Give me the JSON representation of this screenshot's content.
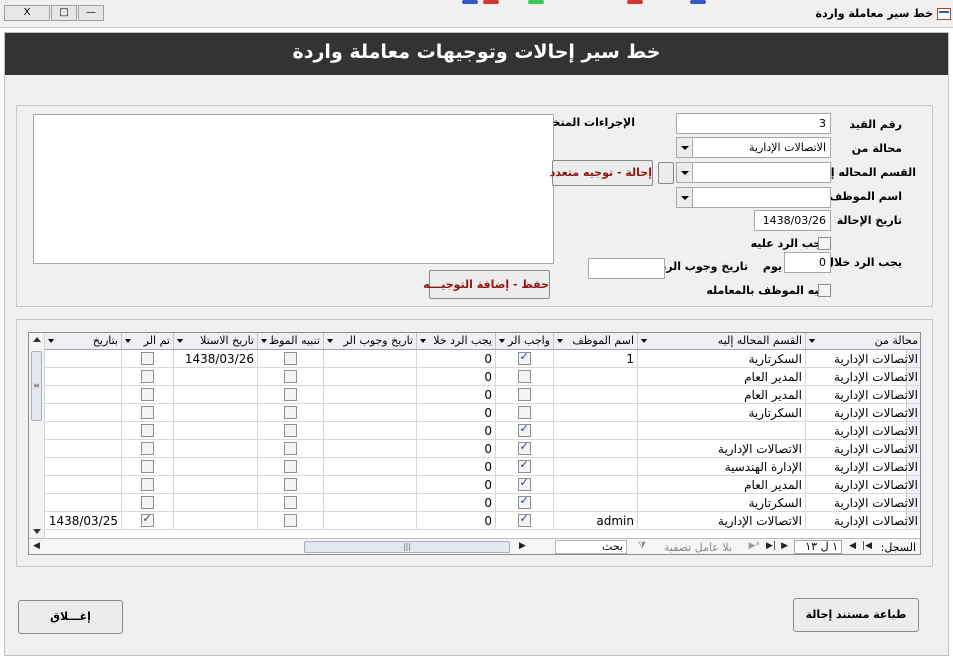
{
  "window": {
    "title": "خط سير معاملة واردة",
    "controls": {
      "close": "X",
      "maximize": "□",
      "minimize": "—"
    }
  },
  "header": {
    "title": "خط سير إحالات وتوجيهات معاملة واردة"
  },
  "form": {
    "record_no_label": "رقم القيد",
    "record_no_value": "3",
    "referred_from_label": "محالة من",
    "referred_from_value": "الاتصالات الإدارية",
    "referred_to_dept_label": "القسم المحاله إليه",
    "referred_to_dept_value": "",
    "employee_name_label": "اسم الموظف",
    "employee_name_value": "",
    "referral_date_label": "تاريخ الإحالة",
    "referral_date_value": "1438/03/26",
    "reply_required_label": "واجب الرد عليه",
    "reply_required_checked": false,
    "reply_within_label": "يجب الرد خلال",
    "reply_within_value": "0",
    "day_label": "يوم",
    "reply_due_date_label": "تاريخ وجوب الرد",
    "reply_due_date_value": "",
    "notify_employee_label": "تنبيه الموظف بالمعامله",
    "notify_employee_checked": false,
    "actions_taken_label": "الإجراءات المتخذه",
    "actions_taken_value": "",
    "multi_referral_button": "إحالة - توجيه متعدد",
    "save_button": "حفظ - إضافة التوجيـــه"
  },
  "grid": {
    "columns": [
      {
        "key": "from",
        "label": "محالة من"
      },
      {
        "key": "dept",
        "label": "القسم المحاله إليه"
      },
      {
        "key": "employee",
        "label": "اسم الموظف"
      },
      {
        "key": "must_reply",
        "label": "واجب الر"
      },
      {
        "key": "reply_within",
        "label": "يجب الرد خلا"
      },
      {
        "key": "due_date",
        "label": "تاريخ وجوب الر"
      },
      {
        "key": "notify",
        "label": "تنبيه الموظ"
      },
      {
        "key": "received_date",
        "label": "تاريخ الاستلا"
      },
      {
        "key": "done",
        "label": "تم الر"
      },
      {
        "key": "on_date",
        "label": "بتاريخ"
      }
    ],
    "rows": [
      {
        "from": "الاتصالات الإدارية",
        "dept": "السكرتارية",
        "employee": "1",
        "must_reply": true,
        "reply_within": "0",
        "due_date": "",
        "notify": false,
        "received_date": "1438/03/26",
        "done": false,
        "on_date": ""
      },
      {
        "from": "الاتصالات الإدارية",
        "dept": "المدير العام",
        "employee": "",
        "must_reply": false,
        "reply_within": "0",
        "due_date": "",
        "notify": false,
        "received_date": "",
        "done": false,
        "on_date": ""
      },
      {
        "from": "الاتصالات الإدارية",
        "dept": "المدير العام",
        "employee": "",
        "must_reply": false,
        "reply_within": "0",
        "due_date": "",
        "notify": false,
        "received_date": "",
        "done": false,
        "on_date": ""
      },
      {
        "from": "الاتصالات الإدارية",
        "dept": "السكرتارية",
        "employee": "",
        "must_reply": false,
        "reply_within": "0",
        "due_date": "",
        "notify": false,
        "received_date": "",
        "done": false,
        "on_date": ""
      },
      {
        "from": "الاتصالات الإدارية",
        "dept": "",
        "employee": "",
        "must_reply": true,
        "reply_within": "0",
        "due_date": "",
        "notify": false,
        "received_date": "",
        "done": false,
        "on_date": ""
      },
      {
        "from": "الاتصالات الإدارية",
        "dept": "الاتصالات الإدارية",
        "employee": "",
        "must_reply": true,
        "reply_within": "0",
        "due_date": "",
        "notify": false,
        "received_date": "",
        "done": false,
        "on_date": ""
      },
      {
        "from": "الاتصالات الإدارية",
        "dept": "الإدارة الهندسية",
        "employee": "",
        "must_reply": true,
        "reply_within": "0",
        "due_date": "",
        "notify": false,
        "received_date": "",
        "done": false,
        "on_date": ""
      },
      {
        "from": "الاتصالات الإدارية",
        "dept": "المدير العام",
        "employee": "",
        "must_reply": true,
        "reply_within": "0",
        "due_date": "",
        "notify": false,
        "received_date": "",
        "done": false,
        "on_date": ""
      },
      {
        "from": "الاتصالات الإدارية",
        "dept": "السكرتارية",
        "employee": "",
        "must_reply": true,
        "reply_within": "0",
        "due_date": "",
        "notify": false,
        "received_date": "",
        "done": false,
        "on_date": ""
      },
      {
        "from": "الاتصالات الإدارية",
        "dept": "الاتصالات الإدارية",
        "employee": "admin",
        "must_reply": true,
        "reply_within": "0",
        "due_date": "",
        "notify": false,
        "received_date": "",
        "done": true,
        "on_date": "1438/03/25"
      }
    ],
    "navigator": {
      "record_label": "السجل:",
      "record_position": "١ ل ١٣",
      "filter_label": "بلا عامل تصفية",
      "search_label": "بحث"
    }
  },
  "footer": {
    "print_button": "طباعة مستند إحالة",
    "close_button": "إغـــلاق"
  },
  "colors": {
    "header_band": "#333333",
    "button_red_text": "#9a1010",
    "panel_bg": "#f0f0f0"
  }
}
